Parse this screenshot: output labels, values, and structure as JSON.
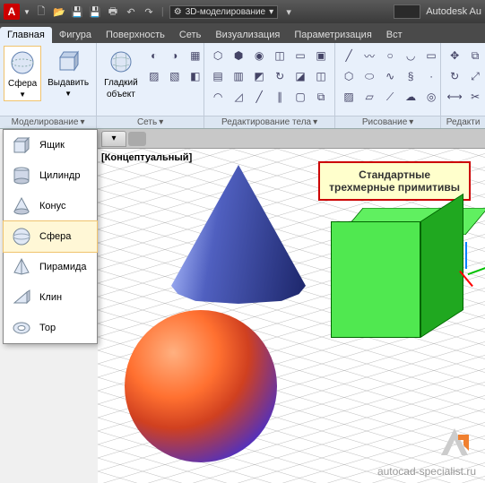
{
  "titlebar": {
    "app_letter": "A",
    "workspace": "3D-моделирование",
    "app_name": "Autodesk Au"
  },
  "tabs": [
    "Главная",
    "Фигура",
    "Поверхность",
    "Сеть",
    "Визуализация",
    "Параметризация",
    "Вст"
  ],
  "ribbon": {
    "sphere": {
      "label": "Сфера"
    },
    "extrude": {
      "label": "Выдавить"
    },
    "smooth": {
      "line1": "Гладкий",
      "line2": "объект"
    },
    "panel_model": "Моделирование",
    "panel_mesh": "Сеть",
    "panel_solidedit": "Редактирование тела",
    "panel_draw": "Рисование",
    "panel_modify": "Редакти"
  },
  "dropdown": {
    "items": [
      "Ящик",
      "Цилиндр",
      "Конус",
      "Сфера",
      "Пирамида",
      "Клин",
      "Тор"
    ],
    "hovered_index": 3
  },
  "viewport": {
    "style_label": "[Концептуальный]",
    "callout_line1": "Стандартные",
    "callout_line2": "трехмерные примитивы"
  },
  "watermark": "autocad-specialist.ru"
}
